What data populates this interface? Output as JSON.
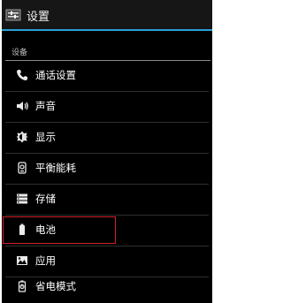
{
  "header": {
    "title": "设置",
    "icon": "settings-icon"
  },
  "section": {
    "title": "设备"
  },
  "items": [
    {
      "label": "通话设置",
      "icon": "phone-icon"
    },
    {
      "label": "声音",
      "icon": "speaker-icon"
    },
    {
      "label": "显示",
      "icon": "brightness-icon"
    },
    {
      "label": "平衡能耗",
      "icon": "power-balance-icon"
    },
    {
      "label": "存储",
      "icon": "storage-icon"
    },
    {
      "label": "电池",
      "icon": "battery-icon"
    },
    {
      "label": "应用",
      "icon": "apps-icon"
    },
    {
      "label": "省电模式",
      "icon": "power-saving-icon"
    }
  ],
  "colors": {
    "accent": "#2a9fd6",
    "highlight": "#d21f2c"
  }
}
